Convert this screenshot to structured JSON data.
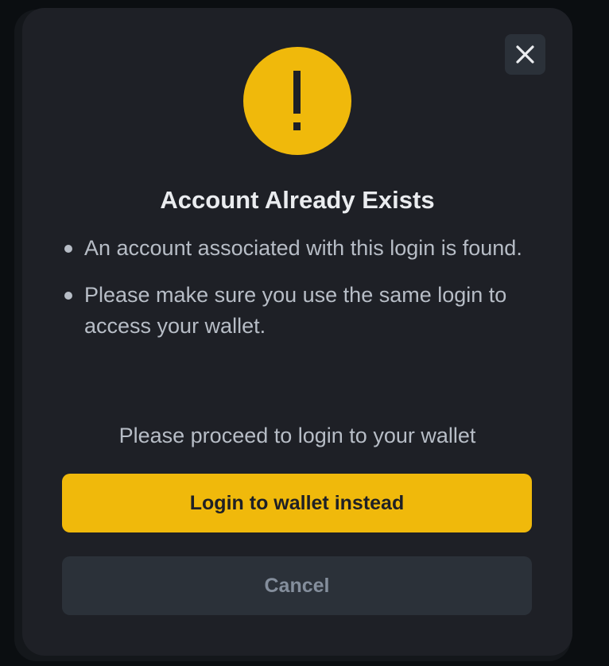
{
  "dialog": {
    "title": "Account Already Exists",
    "bullets": [
      {
        "text": "An account associated with this login is found."
      },
      {
        "text": "Please make sure you use the same login to access your wallet."
      }
    ],
    "proceed_text": "Please proceed to login to your wallet",
    "primary_button_label": "Login to wallet instead",
    "cancel_button_label": "Cancel",
    "icons": {
      "warning": "exclamation-icon",
      "close": "close-icon"
    }
  },
  "colors": {
    "accent": "#f0b90b",
    "modal_background": "#1e2026",
    "page_background": "#0b0e11",
    "secondary_button": "#2b3139",
    "title_text": "#eaecef",
    "body_text": "#b7bdc6",
    "muted_text": "#848e9c"
  }
}
